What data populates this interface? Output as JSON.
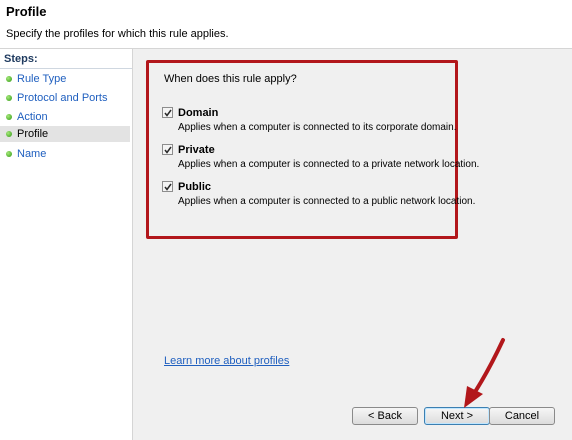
{
  "header": {
    "title": "Profile",
    "subtitle": "Specify the profiles for which this rule applies."
  },
  "sidebar": {
    "heading": "Steps:",
    "items": [
      {
        "label": "Rule Type"
      },
      {
        "label": "Protocol and Ports"
      },
      {
        "label": "Action"
      },
      {
        "label": "Profile",
        "active": true
      },
      {
        "label": "Name"
      }
    ]
  },
  "main": {
    "question": "When does this rule apply?",
    "options": [
      {
        "name": "Domain",
        "checked": true,
        "description": "Applies when a computer is connected to its corporate domain."
      },
      {
        "name": "Private",
        "checked": true,
        "description": "Applies when a computer is connected to a private network location."
      },
      {
        "name": "Public",
        "checked": true,
        "description": "Applies when a computer is connected to a public network location."
      }
    ],
    "learn_more": "Learn more about profiles"
  },
  "buttons": {
    "back": "< Back",
    "next": "Next >",
    "cancel": "Cancel"
  },
  "colors": {
    "highlight": "#b2171b",
    "link": "#1f5fbf",
    "step_dot": "#2f9a12"
  }
}
